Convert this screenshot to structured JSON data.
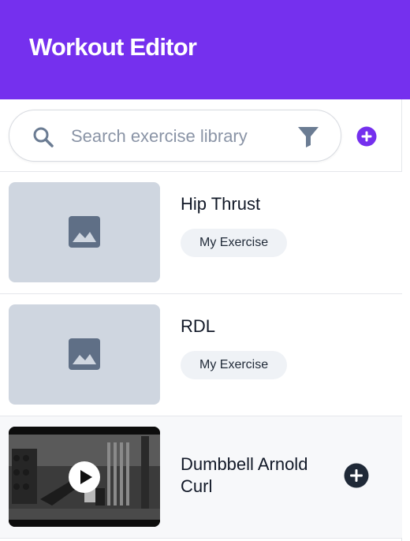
{
  "header": {
    "title": "Workout Editor"
  },
  "search": {
    "placeholder": "Search exercise library",
    "value": ""
  },
  "colors": {
    "brand": "#7530ee",
    "placeholder_bg": "#cfd6e0",
    "badge_bg": "#eff2f6",
    "add_dark": "#1f2937"
  },
  "icons": {
    "search": "search-icon",
    "filter": "filter-icon",
    "add_top": "plus-circle-icon",
    "thumbnail_placeholder": "image-icon",
    "play": "play-icon",
    "add_row": "plus-circle-icon"
  },
  "exercises": [
    {
      "name": "Hip Thrust",
      "badge": "My Exercise",
      "thumbnail": "placeholder"
    },
    {
      "name": "RDL",
      "badge": "My Exercise",
      "thumbnail": "placeholder"
    },
    {
      "name": "Dumbbell Arnold Curl",
      "badge": "",
      "thumbnail": "video"
    }
  ]
}
